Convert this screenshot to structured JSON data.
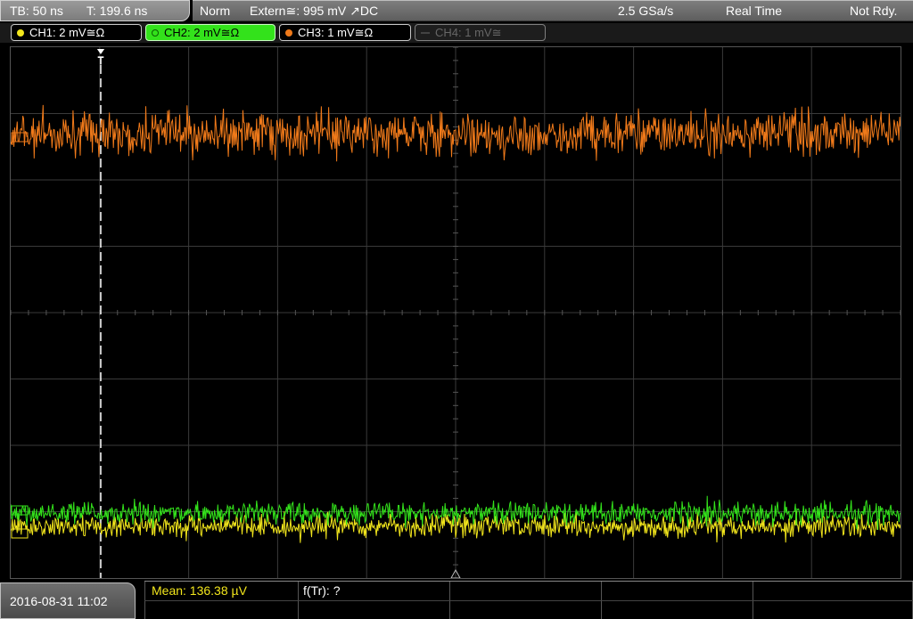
{
  "timebase": {
    "tb": "TB: 50 ns",
    "trigger_time": "T: 199.6 ns"
  },
  "status": {
    "mode": "Norm",
    "trigger": "Extern≅: 995 mV ↗DC",
    "sample_rate": "2.5 GSa/s",
    "acquisition": "Real Time",
    "state": "Not Rdy."
  },
  "channels": [
    {
      "label": "CH1: 2 mV≅Ω",
      "color": "#f2e61c",
      "active": true
    },
    {
      "label": "CH2: 2 mV≅Ω",
      "color": "#33e21b",
      "active": true,
      "selected": true
    },
    {
      "label": "CH3: 1 mV≅Ω",
      "color": "#f07a1a",
      "active": true
    },
    {
      "label": "CH4: 1 mV≅",
      "color": "#555555",
      "active": false
    }
  ],
  "footer": {
    "datetime": "2016-08-31 11:02",
    "measurement_mean": "Mean: 136.38 µV",
    "measurement_ftr": "f(Tr): ?"
  },
  "trace_colors": {
    "ch1": "#f2e61c",
    "ch2": "#33e21b",
    "ch3": "#f07a1a",
    "grid": "#3a3a3a"
  }
}
